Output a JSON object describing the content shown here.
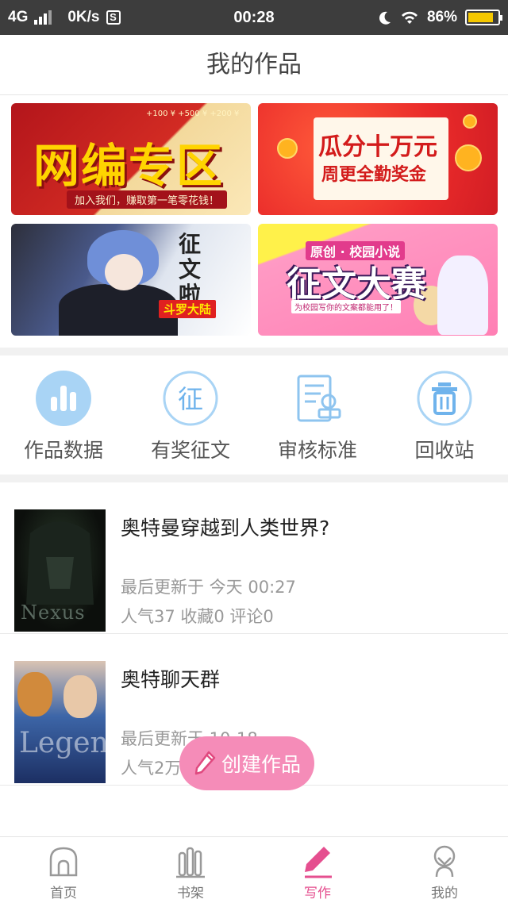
{
  "status_bar": {
    "network": "4G",
    "speed": "0K/s",
    "s_badge": "S",
    "time": "00:28",
    "battery": "86%",
    "battery_level": 0.86,
    "icons": [
      "signal-icon",
      "moon-icon",
      "wifi-icon",
      "battery-icon"
    ]
  },
  "header": {
    "title": "我的作品"
  },
  "banners": [
    {
      "title": "网编专区",
      "sub": "加入我们，赚取第一笔零花钱！",
      "small": "+100 ¥   +500 ¥   +200 ¥"
    },
    {
      "title": "瓜分十万元",
      "sub": "周更全勤奖金"
    },
    {
      "title": "征文啦",
      "tag": "斗罗大陆"
    },
    {
      "top": "原创 · 校园小说",
      "title": "征文大赛",
      "sub": "为校园写你的文案都能用了！"
    }
  ],
  "actions": [
    {
      "label": "作品数据",
      "icon": "bar-chart-icon"
    },
    {
      "label": "有奖征文",
      "icon": "contest-icon",
      "glyph": "征"
    },
    {
      "label": "审核标准",
      "icon": "review-document-icon"
    },
    {
      "label": "回收站",
      "icon": "trash-icon"
    }
  ],
  "works": [
    {
      "title": "奥特曼穿越到人类世界?",
      "updated": "最后更新于 今天 00:27",
      "stats": "人气37  收藏0  评论0",
      "cover_text": "Nexus"
    },
    {
      "title": "奥特聊天群",
      "updated": "最后更新于 10-18",
      "stats": "人气2万  收藏0  评论4",
      "cover_text": "Legend"
    }
  ],
  "create_button": {
    "label": "创建作品",
    "icon": "pencil-icon"
  },
  "bottom_nav": [
    {
      "label": "首页",
      "icon": "home-icon",
      "active": false
    },
    {
      "label": "书架",
      "icon": "bookshelf-icon",
      "active": false
    },
    {
      "label": "写作",
      "icon": "write-pencil-icon",
      "active": true
    },
    {
      "label": "我的",
      "icon": "profile-icon",
      "active": false
    }
  ],
  "colors": {
    "accent": "#e54f8f",
    "icon_blue": "#6fb3ec",
    "create_pink": "#f58cb8",
    "status_bar": "#3d3d3d"
  }
}
